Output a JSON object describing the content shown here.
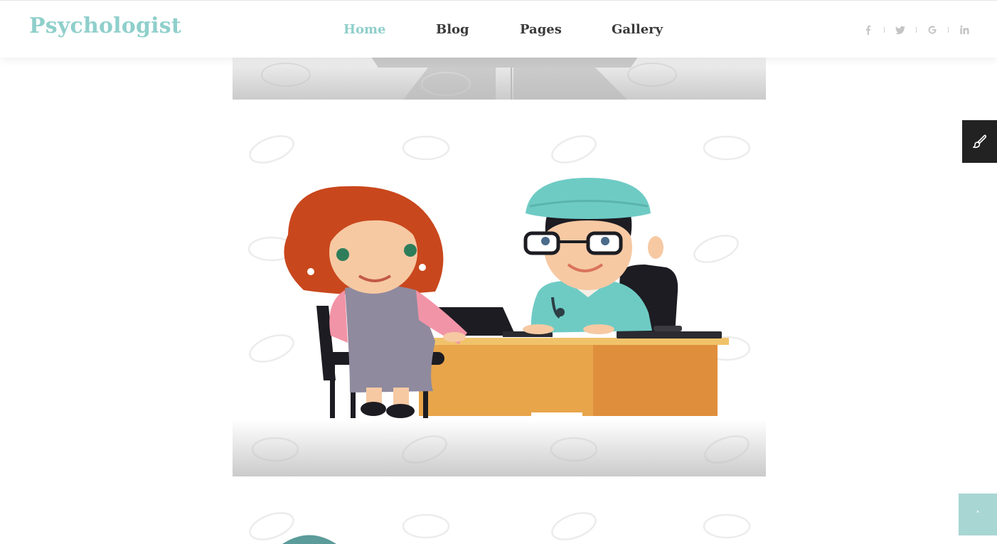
{
  "brand": {
    "name": "Psychologist",
    "accent": "#8fcfcb"
  },
  "nav": {
    "items": [
      {
        "label": "Home",
        "active": true
      },
      {
        "label": "Blog",
        "active": false
      },
      {
        "label": "Pages",
        "active": false
      },
      {
        "label": "Gallery",
        "active": false
      }
    ]
  },
  "social": [
    "facebook-icon",
    "twitter-icon",
    "google-icon",
    "linkedin-icon"
  ],
  "watermark": "123RF",
  "side_tools": {
    "customizer_icon": "brush-icon",
    "scroll_top_glyph": "˄"
  },
  "colors": {
    "text": "#3a3a3a",
    "panel_dark": "#222222",
    "scroll_btn": "#a8d6d3"
  }
}
